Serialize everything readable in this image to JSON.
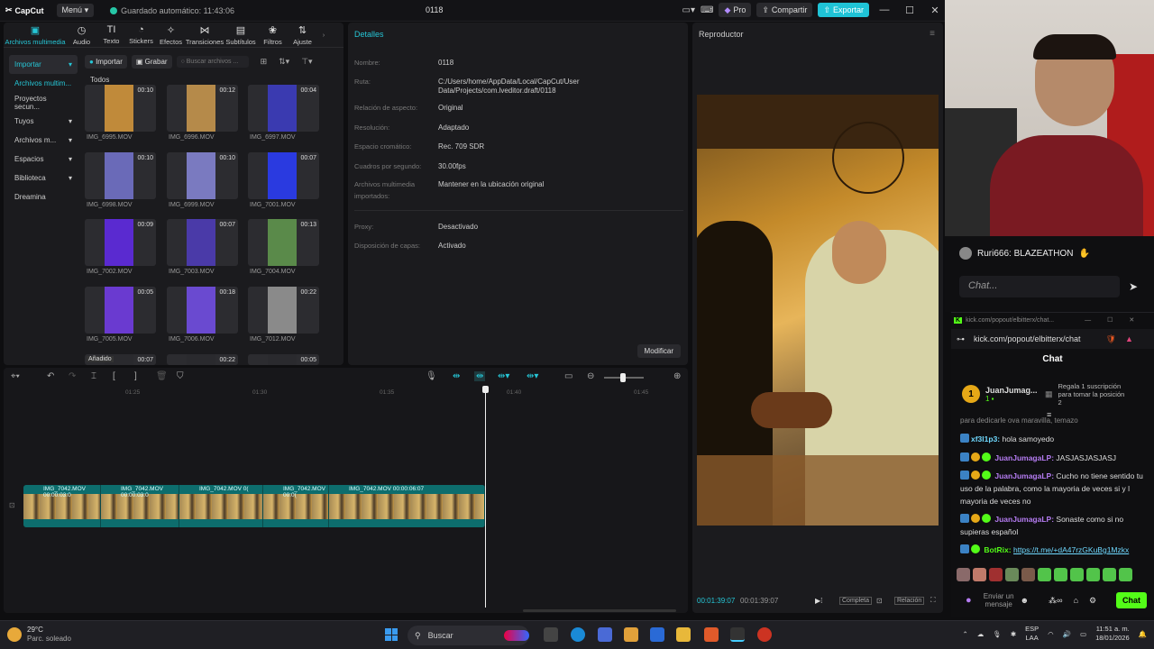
{
  "titlebar": {
    "app_name": "CapCut",
    "menu_label": "Menú",
    "save_status": "Guardado automático: 11:43:06",
    "project_title": "0118",
    "pro_label": "Pro",
    "share_label": "Compartir",
    "export_label": "Exportar"
  },
  "toolbar": {
    "tools": [
      {
        "label": "Archivos multimedia",
        "icon": "media-icon"
      },
      {
        "label": "Audio",
        "icon": "audio-icon"
      },
      {
        "label": "Texto",
        "icon": "text-icon"
      },
      {
        "label": "Stickers",
        "icon": "sticker-icon"
      },
      {
        "label": "Efectos",
        "icon": "effects-icon"
      },
      {
        "label": "Transiciones",
        "icon": "transitions-icon"
      },
      {
        "label": "Subtítulos",
        "icon": "subtitles-icon"
      },
      {
        "label": "Filtros",
        "icon": "filters-icon"
      },
      {
        "label": "Ajuste",
        "icon": "adjust-icon"
      }
    ]
  },
  "sidenav": {
    "items": [
      {
        "label": "Importar"
      },
      {
        "label": "Archivos multim..."
      },
      {
        "label": "Proyectos secun..."
      },
      {
        "label": "Tuyos"
      },
      {
        "label": "Archivos m..."
      },
      {
        "label": "Espacios"
      },
      {
        "label": "Biblioteca"
      },
      {
        "label": "Dreamina"
      }
    ]
  },
  "media": {
    "import_label": "Importar",
    "record_label": "Grabar",
    "search_placeholder": "Buscar archivos ...",
    "section_label": "Todos",
    "added_label": "Añadido",
    "items": [
      {
        "name": "IMG_6995.MOV",
        "duration": "00:10"
      },
      {
        "name": "IMG_6996.MOV",
        "duration": "00:12"
      },
      {
        "name": "IMG_6997.MOV",
        "duration": "00:04"
      },
      {
        "name": "IMG_6998.MOV",
        "duration": "00:10"
      },
      {
        "name": "IMG_6999.MOV",
        "duration": "00:10"
      },
      {
        "name": "IMG_7001.MOV",
        "duration": "00:07"
      },
      {
        "name": "IMG_7002.MOV",
        "duration": "00:09"
      },
      {
        "name": "IMG_7003.MOV",
        "duration": "00:07"
      },
      {
        "name": "IMG_7004.MOV",
        "duration": "00:13"
      },
      {
        "name": "IMG_7005.MOV",
        "duration": "00:05"
      },
      {
        "name": "IMG_7006.MOV",
        "duration": "00:18"
      },
      {
        "name": "IMG_7012.MOV",
        "duration": "00:22"
      },
      {
        "name": "",
        "duration": "00:07"
      },
      {
        "name": "",
        "duration": "00:22"
      },
      {
        "name": "",
        "duration": "00:05"
      }
    ]
  },
  "details": {
    "header": "Detalles",
    "rows": [
      {
        "key": "Nombre:",
        "value": "0118"
      },
      {
        "key": "Ruta:",
        "value": "C:/Users/home/AppData/Local/CapCut/User Data/Projects/com.lveditor.draft/0118"
      },
      {
        "key": "Relación de aspecto:",
        "value": "Original"
      },
      {
        "key": "Resolución:",
        "value": "Adaptado"
      },
      {
        "key": "Espacio cromático:",
        "value": "Rec. 709 SDR"
      },
      {
        "key": "Cuadros por segundo:",
        "value": "30.00fps"
      },
      {
        "key": "Archivos multimedia importados:",
        "value": "Mantener en la ubicación original"
      },
      {
        "key": "Proxy:",
        "value": "Desactivado"
      },
      {
        "key": "Disposición de capas:",
        "value": "Activado"
      }
    ],
    "modify_label": "Modificar"
  },
  "player": {
    "header": "Reproductor",
    "current_time": "00:01:39:07",
    "total_time": "00:01:39:07",
    "full_label": "Completa",
    "ratio_label": "Relación"
  },
  "timeline": {
    "ruler": [
      "01:25",
      "01:30",
      "01:35",
      "01:40",
      "01:45"
    ],
    "clips": [
      {
        "label": "IMG_7042.MOV  00:00:03:0"
      },
      {
        "label": "IMG_7042.MOV  00:00:03:0"
      },
      {
        "label": "IMG_7042.MOV  0("
      },
      {
        "label": "IMG_7042.MOV  00:0("
      },
      {
        "label": "IMG_7042.MOV  00:00:06:07"
      }
    ]
  },
  "stream_chat": {
    "top_message": "Ruri666: BLAZEATHON",
    "input_placeholder": "Chat...",
    "tab_url_short": "kick.com/popout/elbitterx/chat...",
    "url": "kick.com/popout/elbitterx/chat",
    "header": "Chat",
    "pinned_user": "JuanJumag...",
    "pinned_count": "1",
    "pinned_text": "Regala 1 suscripción para tomar la posición 2",
    "partial_line": "para dedicarle ova maravilla, temazo",
    "messages": [
      {
        "user": "xf3l1p3:",
        "text": "hola samoyedo"
      },
      {
        "user": "JuanJumagaLP:",
        "text": "JASJASJASJASJ"
      },
      {
        "user": "JuanJumagaLP:",
        "text": "Cucho no tiene sentido tu uso de la palabra, como la mayoria de veces si y l mayoria de veces no"
      },
      {
        "user": "JuanJumagaLP:",
        "text": "Sonaste como si no supieras español"
      },
      {
        "user": "BotRix:",
        "text": "https://t.me/+dA47rzGKuBg1Mzkx"
      }
    ],
    "send_placeholder": "Enviar un mensaje",
    "chat_button": "Chat"
  },
  "taskbar": {
    "temp": "29°C",
    "weather": "Parc. soleado",
    "search_label": "Buscar",
    "lang1": "ESP",
    "lang2": "LAA",
    "time": "11:51 a. m.",
    "date": "18/01/2026"
  }
}
